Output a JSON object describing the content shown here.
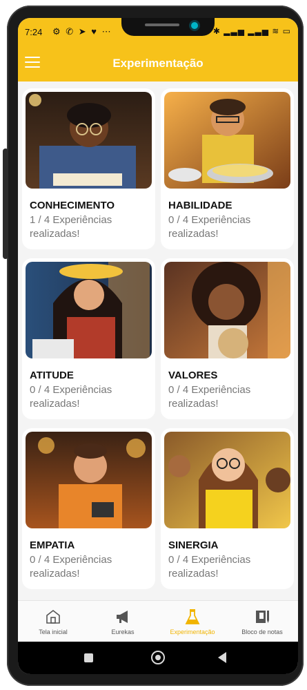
{
  "status_bar": {
    "time": "7:24",
    "left_icons": "⚙ ✆ ➤ ♥ ⋯",
    "right_icons": "✱ ▂▃▅ ▂▃▅ ≋ ▭"
  },
  "app_bar": {
    "title": "Experimentação",
    "menu_icon": "hamburger-menu-icon",
    "background": "#f7c21a"
  },
  "cards": [
    {
      "title": "CONHECIMENTO",
      "progress": "1 / 4 Experiências realizadas!",
      "done": 1,
      "total": 4
    },
    {
      "title": "HABILIDADE",
      "progress": "0 / 4 Experiências realizadas!",
      "done": 0,
      "total": 4
    },
    {
      "title": "ATITUDE",
      "progress": "0 / 4 Experiências realizadas!",
      "done": 0,
      "total": 4
    },
    {
      "title": "VALORES",
      "progress": "0 / 4 Experiências realizadas!",
      "done": 0,
      "total": 4
    },
    {
      "title": "EMPATIA",
      "progress": "0 / 4 Experiências realizadas!",
      "done": 0,
      "total": 4
    },
    {
      "title": "SINERGIA",
      "progress": "0 / 4 Experiências realizadas!",
      "done": 0,
      "total": 4
    }
  ],
  "bottom_nav": {
    "items": [
      {
        "label": "Tela inicial",
        "icon": "home-icon",
        "active": false
      },
      {
        "label": "Eurekas",
        "icon": "megaphone-icon",
        "active": false
      },
      {
        "label": "Experimentação",
        "icon": "flask-icon",
        "active": true
      },
      {
        "label": "Bloco de notas",
        "icon": "notebook-icon",
        "active": false
      }
    ],
    "active_color": "#f1b400"
  },
  "system_nav": {
    "icons": [
      "recent-apps-icon",
      "home-circle-icon",
      "back-icon"
    ]
  }
}
